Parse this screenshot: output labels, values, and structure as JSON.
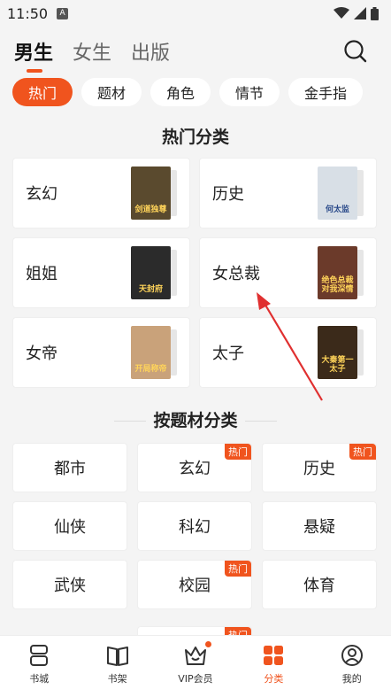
{
  "status_bar": {
    "time": "11:50",
    "badge": "A"
  },
  "header": {
    "tabs": [
      {
        "label": "男生",
        "active": true
      },
      {
        "label": "女生",
        "active": false
      },
      {
        "label": "出版",
        "active": false
      }
    ],
    "search_icon": "search-icon"
  },
  "filters": {
    "chips": [
      {
        "label": "热门",
        "active": true
      },
      {
        "label": "题材",
        "active": false
      },
      {
        "label": "角色",
        "active": false
      },
      {
        "label": "情节",
        "active": false
      },
      {
        "label": "金手指",
        "active": false
      }
    ]
  },
  "hot_section": {
    "title": "热门分类",
    "items": [
      {
        "label": "玄幻",
        "cover_text": "剑道独尊",
        "cover_color": "#5a4a2e"
      },
      {
        "label": "历史",
        "cover_text": "何太监",
        "cover_color": "#d8dfe6"
      },
      {
        "label": "姐姐",
        "cover_text": "天封府",
        "cover_color": "#2b2b2b"
      },
      {
        "label": "女总裁",
        "cover_text": "绝色总裁 对我深情",
        "cover_color": "#6b3a2a"
      },
      {
        "label": "女帝",
        "cover_text": "开局称帝",
        "cover_color": "#c9a27a"
      },
      {
        "label": "太子",
        "cover_text": "大秦第一 太子",
        "cover_color": "#3b2a1a"
      }
    ]
  },
  "theme_section": {
    "title": "按题材分类",
    "hot_badge": "热门",
    "items": [
      {
        "label": "都市",
        "hot": false
      },
      {
        "label": "玄幻",
        "hot": true
      },
      {
        "label": "历史",
        "hot": true
      },
      {
        "label": "仙侠",
        "hot": false
      },
      {
        "label": "科幻",
        "hot": false
      },
      {
        "label": "悬疑",
        "hot": false
      },
      {
        "label": "武侠",
        "hot": false
      },
      {
        "label": "校园",
        "hot": true
      },
      {
        "label": "体育",
        "hot": false
      }
    ]
  },
  "bottom_nav": {
    "items": [
      {
        "label": "书城",
        "icon": "bookstore-icon",
        "active": false
      },
      {
        "label": "书架",
        "icon": "bookshelf-icon",
        "active": false
      },
      {
        "label": "VIP会员",
        "icon": "vip-crown-icon",
        "active": false,
        "dot": true
      },
      {
        "label": "分类",
        "icon": "category-grid-icon",
        "active": true
      },
      {
        "label": "我的",
        "icon": "profile-icon",
        "active": false
      }
    ]
  },
  "colors": {
    "accent": "#f0541e",
    "background": "#f4f4f4",
    "annotation_arrow": "#e03030"
  }
}
